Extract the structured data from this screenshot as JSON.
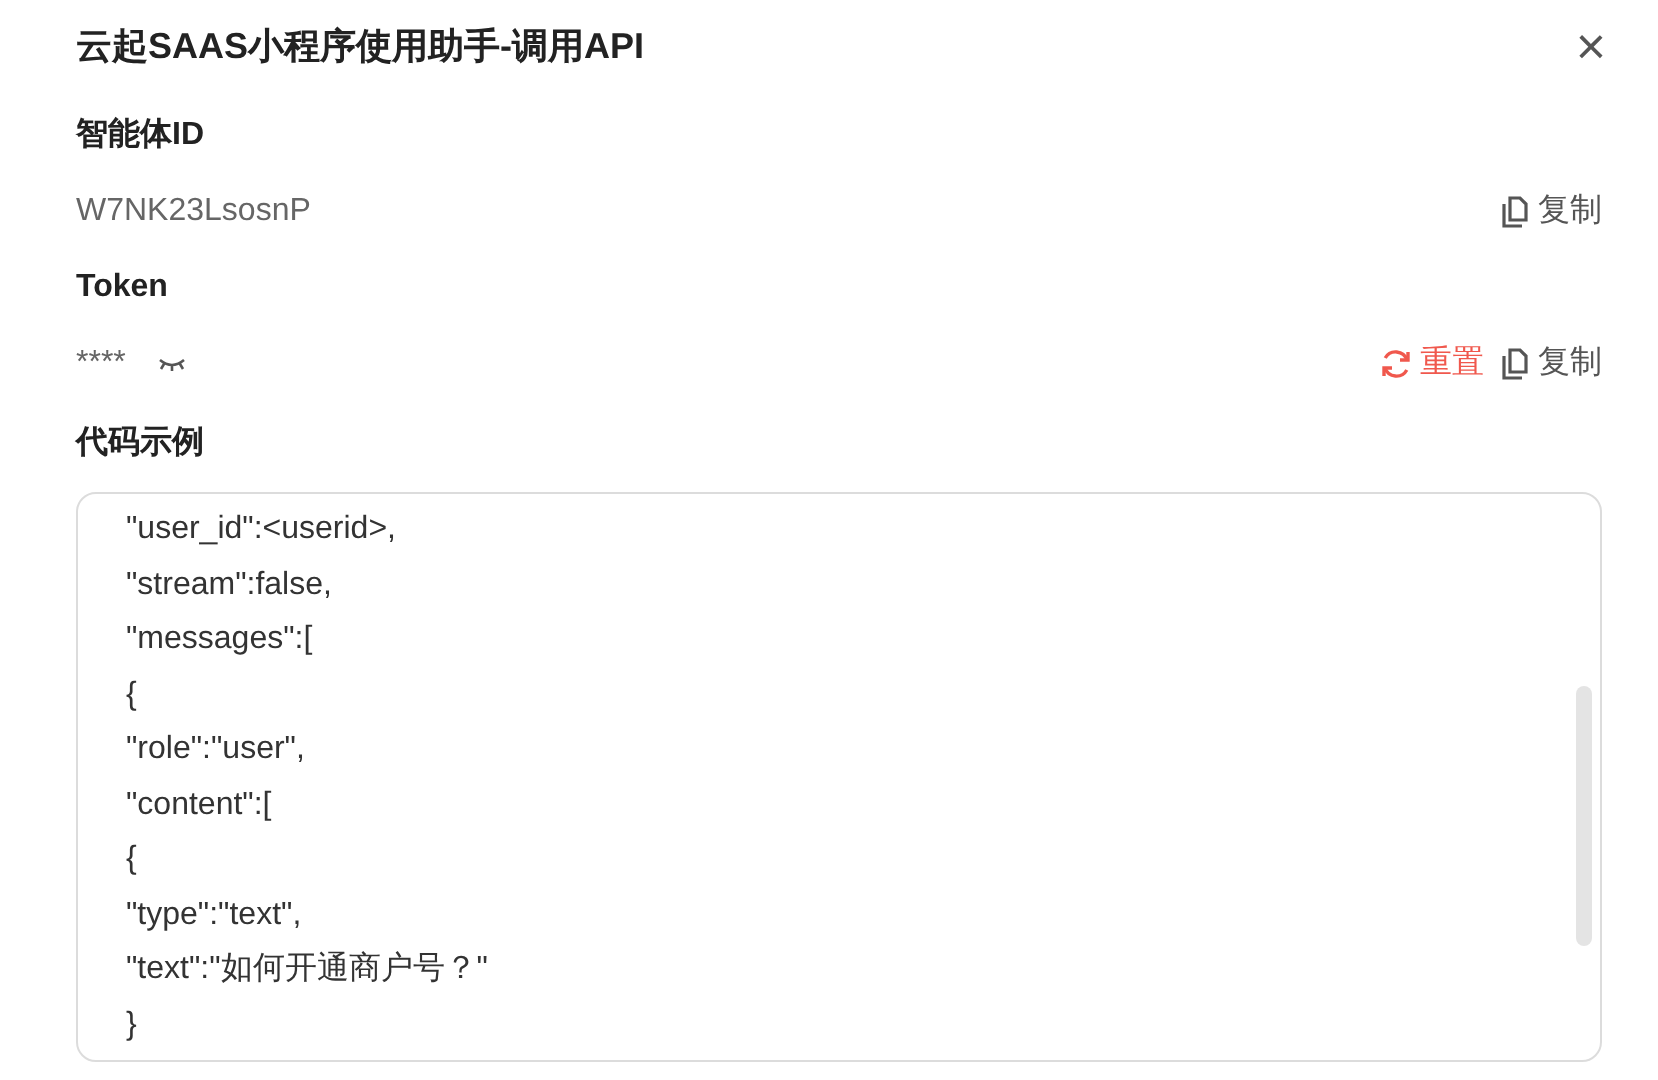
{
  "dialog": {
    "title": "云起SAAS小程序使用助手-调用API",
    "close": "×"
  },
  "agent_id": {
    "label": "智能体ID",
    "value": "W7NK23LsosnP",
    "actions": [
      {
        "kind": "copy",
        "label": "复制"
      }
    ]
  },
  "token": {
    "label": "Token",
    "value": "****",
    "revealed": false,
    "actions": [
      {
        "kind": "reset",
        "label": "重置"
      },
      {
        "kind": "copy",
        "label": "复制"
      }
    ]
  },
  "code_example": {
    "label": "代码示例",
    "lines": [
      "\"user_id\":<userid>,",
      "\"stream\":false,",
      "\"messages\":[",
      "{",
      "\"role\":\"user\",",
      "\"content\":[",
      "{",
      "\"type\":\"text\",",
      "\"text\":\"如何开通商户号？\"",
      "}"
    ]
  }
}
